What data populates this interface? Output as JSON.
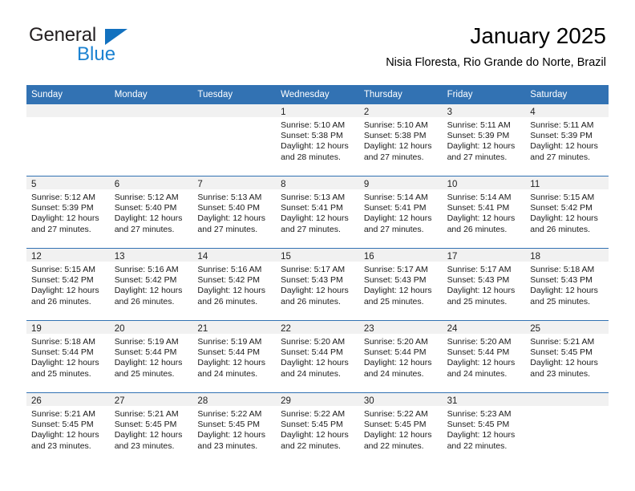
{
  "brand": {
    "line1": "General",
    "line2": "Blue",
    "accent_color": "#1b82d1",
    "triangle_color": "#1271bf"
  },
  "header": {
    "title": "January 2025",
    "subtitle": "Nisia Floresta, Rio Grande do Norte, Brazil",
    "header_bg_color": "#3272b3",
    "header_text_color": "#ffffff"
  },
  "weekdays": [
    "Sunday",
    "Monday",
    "Tuesday",
    "Wednesday",
    "Thursday",
    "Friday",
    "Saturday"
  ],
  "labels": {
    "sunrise_prefix": "Sunrise:",
    "sunset_prefix": "Sunset:",
    "daylight_prefix": "Daylight:"
  },
  "weeks": [
    [
      {
        "day": "",
        "empty": true
      },
      {
        "day": "",
        "empty": true
      },
      {
        "day": "",
        "empty": true
      },
      {
        "day": "1",
        "sunrise": "Sunrise: 5:10 AM",
        "sunset": "Sunset: 5:38 PM",
        "daylight_l1": "Daylight: 12 hours",
        "daylight_l2": "and 28 minutes."
      },
      {
        "day": "2",
        "sunrise": "Sunrise: 5:10 AM",
        "sunset": "Sunset: 5:38 PM",
        "daylight_l1": "Daylight: 12 hours",
        "daylight_l2": "and 27 minutes."
      },
      {
        "day": "3",
        "sunrise": "Sunrise: 5:11 AM",
        "sunset": "Sunset: 5:39 PM",
        "daylight_l1": "Daylight: 12 hours",
        "daylight_l2": "and 27 minutes."
      },
      {
        "day": "4",
        "sunrise": "Sunrise: 5:11 AM",
        "sunset": "Sunset: 5:39 PM",
        "daylight_l1": "Daylight: 12 hours",
        "daylight_l2": "and 27 minutes."
      }
    ],
    [
      {
        "day": "5",
        "sunrise": "Sunrise: 5:12 AM",
        "sunset": "Sunset: 5:39 PM",
        "daylight_l1": "Daylight: 12 hours",
        "daylight_l2": "and 27 minutes."
      },
      {
        "day": "6",
        "sunrise": "Sunrise: 5:12 AM",
        "sunset": "Sunset: 5:40 PM",
        "daylight_l1": "Daylight: 12 hours",
        "daylight_l2": "and 27 minutes."
      },
      {
        "day": "7",
        "sunrise": "Sunrise: 5:13 AM",
        "sunset": "Sunset: 5:40 PM",
        "daylight_l1": "Daylight: 12 hours",
        "daylight_l2": "and 27 minutes."
      },
      {
        "day": "8",
        "sunrise": "Sunrise: 5:13 AM",
        "sunset": "Sunset: 5:41 PM",
        "daylight_l1": "Daylight: 12 hours",
        "daylight_l2": "and 27 minutes."
      },
      {
        "day": "9",
        "sunrise": "Sunrise: 5:14 AM",
        "sunset": "Sunset: 5:41 PM",
        "daylight_l1": "Daylight: 12 hours",
        "daylight_l2": "and 27 minutes."
      },
      {
        "day": "10",
        "sunrise": "Sunrise: 5:14 AM",
        "sunset": "Sunset: 5:41 PM",
        "daylight_l1": "Daylight: 12 hours",
        "daylight_l2": "and 26 minutes."
      },
      {
        "day": "11",
        "sunrise": "Sunrise: 5:15 AM",
        "sunset": "Sunset: 5:42 PM",
        "daylight_l1": "Daylight: 12 hours",
        "daylight_l2": "and 26 minutes."
      }
    ],
    [
      {
        "day": "12",
        "sunrise": "Sunrise: 5:15 AM",
        "sunset": "Sunset: 5:42 PM",
        "daylight_l1": "Daylight: 12 hours",
        "daylight_l2": "and 26 minutes."
      },
      {
        "day": "13",
        "sunrise": "Sunrise: 5:16 AM",
        "sunset": "Sunset: 5:42 PM",
        "daylight_l1": "Daylight: 12 hours",
        "daylight_l2": "and 26 minutes."
      },
      {
        "day": "14",
        "sunrise": "Sunrise: 5:16 AM",
        "sunset": "Sunset: 5:42 PM",
        "daylight_l1": "Daylight: 12 hours",
        "daylight_l2": "and 26 minutes."
      },
      {
        "day": "15",
        "sunrise": "Sunrise: 5:17 AM",
        "sunset": "Sunset: 5:43 PM",
        "daylight_l1": "Daylight: 12 hours",
        "daylight_l2": "and 26 minutes."
      },
      {
        "day": "16",
        "sunrise": "Sunrise: 5:17 AM",
        "sunset": "Sunset: 5:43 PM",
        "daylight_l1": "Daylight: 12 hours",
        "daylight_l2": "and 25 minutes."
      },
      {
        "day": "17",
        "sunrise": "Sunrise: 5:17 AM",
        "sunset": "Sunset: 5:43 PM",
        "daylight_l1": "Daylight: 12 hours",
        "daylight_l2": "and 25 minutes."
      },
      {
        "day": "18",
        "sunrise": "Sunrise: 5:18 AM",
        "sunset": "Sunset: 5:43 PM",
        "daylight_l1": "Daylight: 12 hours",
        "daylight_l2": "and 25 minutes."
      }
    ],
    [
      {
        "day": "19",
        "sunrise": "Sunrise: 5:18 AM",
        "sunset": "Sunset: 5:44 PM",
        "daylight_l1": "Daylight: 12 hours",
        "daylight_l2": "and 25 minutes."
      },
      {
        "day": "20",
        "sunrise": "Sunrise: 5:19 AM",
        "sunset": "Sunset: 5:44 PM",
        "daylight_l1": "Daylight: 12 hours",
        "daylight_l2": "and 25 minutes."
      },
      {
        "day": "21",
        "sunrise": "Sunrise: 5:19 AM",
        "sunset": "Sunset: 5:44 PM",
        "daylight_l1": "Daylight: 12 hours",
        "daylight_l2": "and 24 minutes."
      },
      {
        "day": "22",
        "sunrise": "Sunrise: 5:20 AM",
        "sunset": "Sunset: 5:44 PM",
        "daylight_l1": "Daylight: 12 hours",
        "daylight_l2": "and 24 minutes."
      },
      {
        "day": "23",
        "sunrise": "Sunrise: 5:20 AM",
        "sunset": "Sunset: 5:44 PM",
        "daylight_l1": "Daylight: 12 hours",
        "daylight_l2": "and 24 minutes."
      },
      {
        "day": "24",
        "sunrise": "Sunrise: 5:20 AM",
        "sunset": "Sunset: 5:44 PM",
        "daylight_l1": "Daylight: 12 hours",
        "daylight_l2": "and 24 minutes."
      },
      {
        "day": "25",
        "sunrise": "Sunrise: 5:21 AM",
        "sunset": "Sunset: 5:45 PM",
        "daylight_l1": "Daylight: 12 hours",
        "daylight_l2": "and 23 minutes."
      }
    ],
    [
      {
        "day": "26",
        "sunrise": "Sunrise: 5:21 AM",
        "sunset": "Sunset: 5:45 PM",
        "daylight_l1": "Daylight: 12 hours",
        "daylight_l2": "and 23 minutes."
      },
      {
        "day": "27",
        "sunrise": "Sunrise: 5:21 AM",
        "sunset": "Sunset: 5:45 PM",
        "daylight_l1": "Daylight: 12 hours",
        "daylight_l2": "and 23 minutes."
      },
      {
        "day": "28",
        "sunrise": "Sunrise: 5:22 AM",
        "sunset": "Sunset: 5:45 PM",
        "daylight_l1": "Daylight: 12 hours",
        "daylight_l2": "and 23 minutes."
      },
      {
        "day": "29",
        "sunrise": "Sunrise: 5:22 AM",
        "sunset": "Sunset: 5:45 PM",
        "daylight_l1": "Daylight: 12 hours",
        "daylight_l2": "and 22 minutes."
      },
      {
        "day": "30",
        "sunrise": "Sunrise: 5:22 AM",
        "sunset": "Sunset: 5:45 PM",
        "daylight_l1": "Daylight: 12 hours",
        "daylight_l2": "and 22 minutes."
      },
      {
        "day": "31",
        "sunrise": "Sunrise: 5:23 AM",
        "sunset": "Sunset: 5:45 PM",
        "daylight_l1": "Daylight: 12 hours",
        "daylight_l2": "and 22 minutes."
      },
      {
        "day": "",
        "empty": true
      }
    ]
  ]
}
